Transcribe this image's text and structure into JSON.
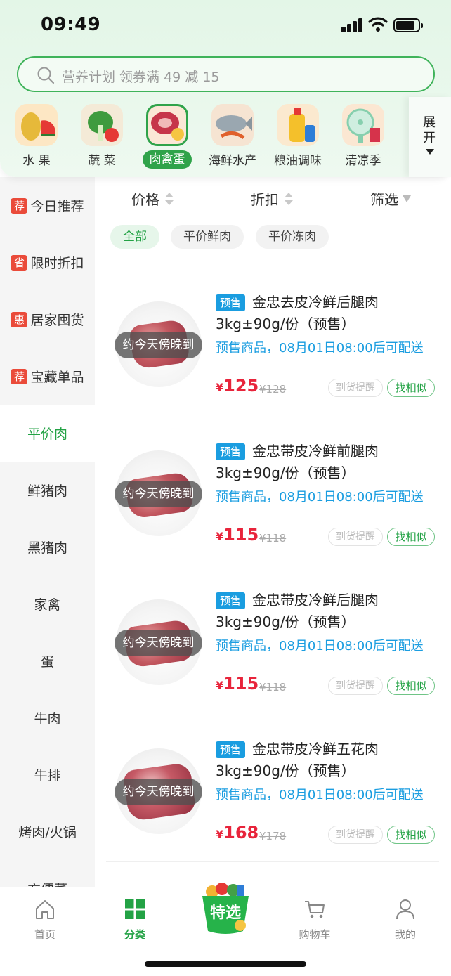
{
  "status_bar": {
    "time": "09:49"
  },
  "search": {
    "placeholder": "营养计划 领券满 49 减 15"
  },
  "categories": [
    {
      "label": "水  果",
      "icon": "durian-watermelon-icon"
    },
    {
      "label": "蔬  菜",
      "icon": "vegetables-icon"
    },
    {
      "label": "肉禽蛋",
      "icon": "meat-icon",
      "active": true
    },
    {
      "label": "海鲜水产",
      "icon": "fish-icon"
    },
    {
      "label": "粮油调味",
      "icon": "oil-bottle-icon"
    },
    {
      "label": "清凉季",
      "icon": "fan-icon"
    }
  ],
  "expand": {
    "label": "展开"
  },
  "sidebar": {
    "items": [
      {
        "tag": "荐",
        "label": "今日推荐"
      },
      {
        "tag": "省",
        "label": "限时折扣"
      },
      {
        "tag": "惠",
        "label": "居家囤货"
      },
      {
        "tag": "荐",
        "label": "宝藏单品"
      },
      {
        "label": "平价肉",
        "active": true
      },
      {
        "label": "鲜猪肉"
      },
      {
        "label": "黑猪肉"
      },
      {
        "label": "家禽"
      },
      {
        "label": "蛋"
      },
      {
        "label": "牛肉"
      },
      {
        "label": "牛排"
      },
      {
        "label": "烤肉/火锅"
      },
      {
        "label": "方便菜"
      }
    ]
  },
  "sort_bar": {
    "price": "价格",
    "discount": "折扣",
    "filter": "筛选"
  },
  "chips": [
    {
      "label": "全部",
      "active": true
    },
    {
      "label": "平价鲜肉"
    },
    {
      "label": "平价冻肉"
    }
  ],
  "products": [
    {
      "tag": "预售",
      "title": "金忠去皮冷鲜后腿肉3kg±90g/份（预售）",
      "note": "预售商品，08月01日08:00后可配送",
      "eta": "约今天傍晚到",
      "currency": "¥",
      "price": "125",
      "old_price": "¥128",
      "notify": "到货提醒",
      "similar": "找相似"
    },
    {
      "tag": "预售",
      "title": "金忠带皮冷鲜前腿肉3kg±90g/份（预售）",
      "note": "预售商品，08月01日08:00后可配送",
      "eta": "约今天傍晚到",
      "currency": "¥",
      "price": "115",
      "old_price": "¥118",
      "notify": "到货提醒",
      "similar": "找相似"
    },
    {
      "tag": "预售",
      "title": "金忠带皮冷鲜后腿肉3kg±90g/份（预售）",
      "note": "预售商品，08月01日08:00后可配送",
      "eta": "约今天傍晚到",
      "currency": "¥",
      "price": "115",
      "old_price": "¥118",
      "notify": "到货提醒",
      "similar": "找相似"
    },
    {
      "tag": "预售",
      "title": "金忠带皮冷鲜五花肉3kg±90g/份（预售）",
      "note": "预售商品，08月01日08:00后可配送",
      "eta": "约今天傍晚到",
      "currency": "¥",
      "price": "168",
      "old_price": "¥178",
      "notify": "到货提醒",
      "similar": "找相似"
    }
  ],
  "tabbar": {
    "items": [
      {
        "label": "首页",
        "icon": "home-icon"
      },
      {
        "label": "分类",
        "icon": "category-grid-icon",
        "active": true
      },
      {
        "label": "特选",
        "icon": "featured-basket-icon"
      },
      {
        "label": "购物车",
        "icon": "cart-icon"
      },
      {
        "label": "我的",
        "icon": "profile-icon"
      }
    ]
  },
  "colors": {
    "brand_green": "#23a245",
    "price_red": "#e8243b",
    "presale_blue": "#1a9de0",
    "tag_red": "#ea4b3a"
  }
}
